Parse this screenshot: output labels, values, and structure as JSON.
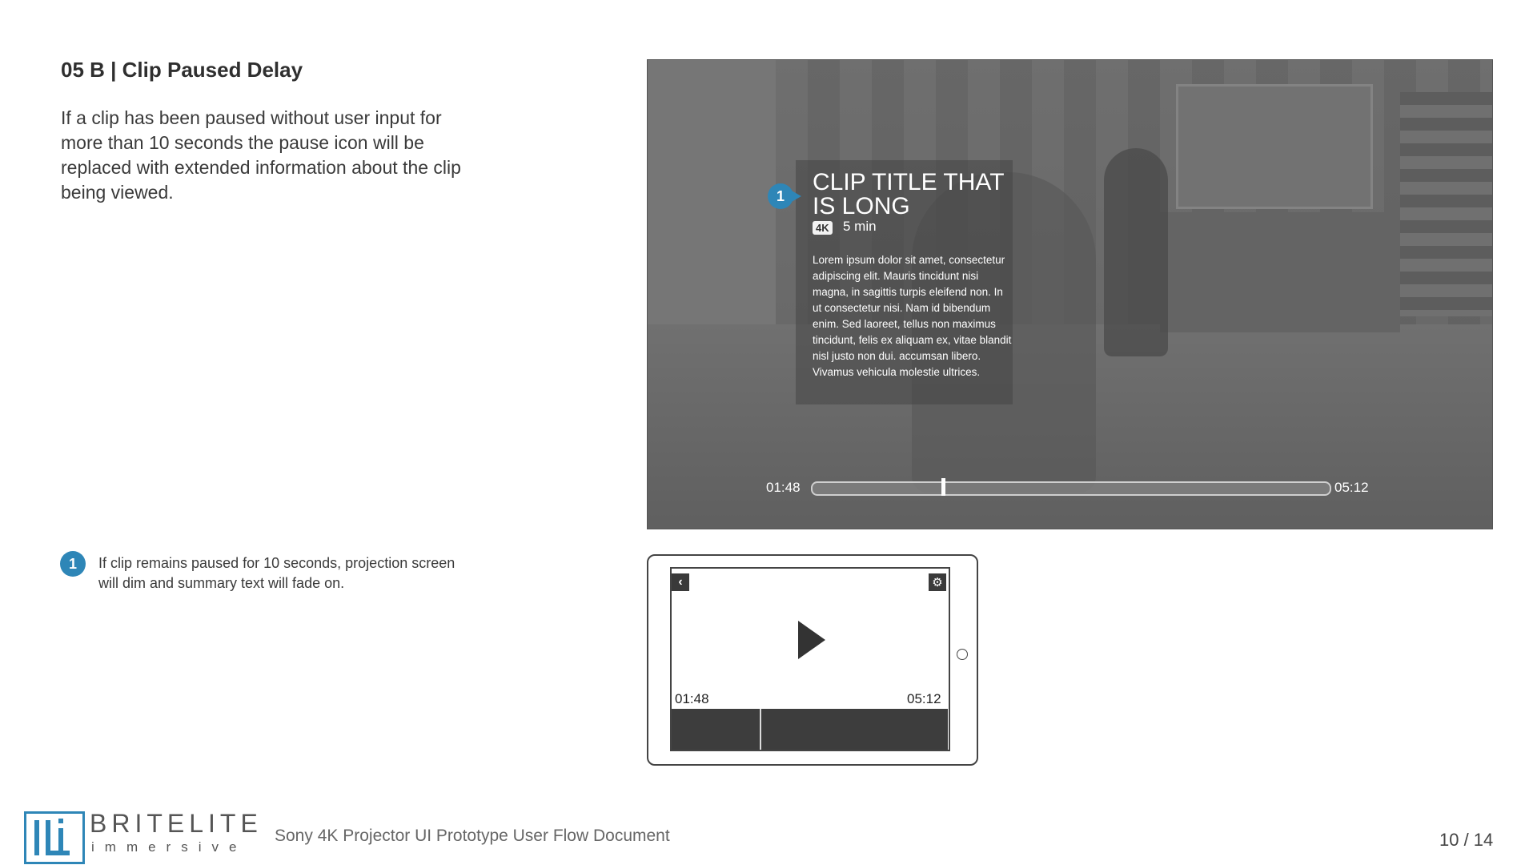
{
  "slide": {
    "title": "05 B | Clip Paused Delay",
    "description": "If a clip has been paused without user input for more than 10 seconds the pause icon will be replaced with extended information about the clip being viewed."
  },
  "annotation": {
    "number": "1",
    "text": "If clip remains paused for 10 seconds, projection screen will dim and summary text will fade on."
  },
  "projection": {
    "badge_number": "1",
    "clip_title": "CLIP TITLE THAT IS LONG",
    "resolution_badge": "4K",
    "duration": "5 min",
    "synopsis": "Lorem ipsum dolor sit amet, consectetur adipiscing elit. Mauris tincidunt nisi magna, in sagittis turpis eleifend non. In ut consectetur nisi. Nam id bibendum enim. Sed laoreet, tellus non maximus tincidunt, felis ex aliquam ex, vitae blandit nisl justo non dui. accumsan libero. Vivamus vehicula molestie ultrices.",
    "elapsed": "01:48",
    "total": "05:12",
    "progress_fraction": 0.25
  },
  "tablet": {
    "back_icon": "chevron-left-icon",
    "settings_icon": "gear-icon",
    "play_icon": "play-icon",
    "elapsed": "01:48",
    "total": "05:12",
    "progress_fraction": 0.32
  },
  "footer": {
    "brand_name": "BRITELITE",
    "brand_sub": "immersive",
    "document_title": "Sony 4K Projector UI Prototype User Flow Document",
    "page_number": "10 / 14"
  },
  "colors": {
    "accent": "#2e86b7"
  }
}
